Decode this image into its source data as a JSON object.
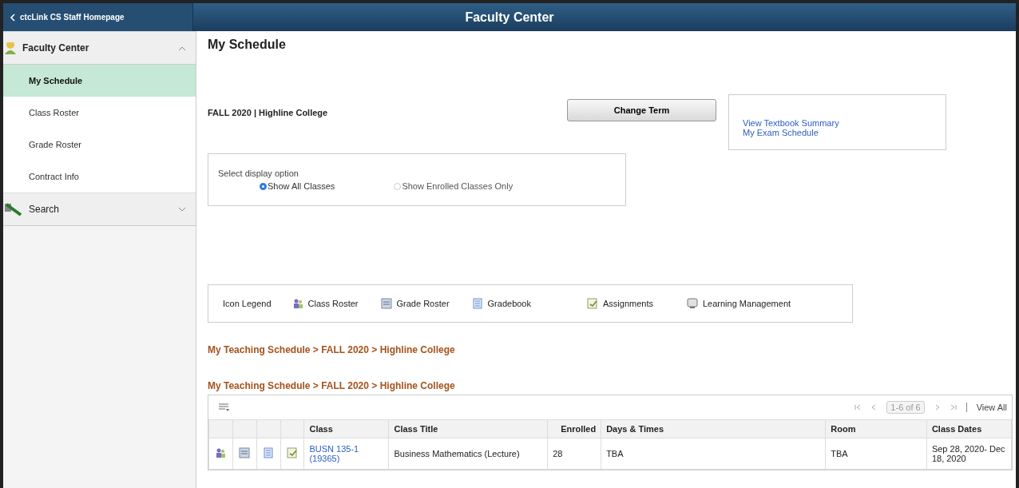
{
  "header": {
    "back_label": "ctcLink CS Staff Homepage",
    "title": "Faculty Center"
  },
  "sidebar": {
    "groups": [
      {
        "label": "Faculty Center",
        "expanded": true,
        "items": [
          {
            "label": "My Schedule",
            "selected": true
          },
          {
            "label": "Class Roster",
            "selected": false
          },
          {
            "label": "Grade Roster",
            "selected": false
          },
          {
            "label": "Contract Info",
            "selected": false
          }
        ]
      },
      {
        "label": "Search",
        "expanded": false
      }
    ]
  },
  "page_title": "My Schedule",
  "term": "FALL 2020 | Highline College",
  "change_term_button": "Change Term",
  "links": [
    "View Textbook Summary",
    "My Exam Schedule"
  ],
  "display_option": {
    "label": "Select display option",
    "options": [
      {
        "label": "Show All Classes",
        "selected": true
      },
      {
        "label": "Show Enrolled Classes Only",
        "selected": false
      }
    ]
  },
  "legend": {
    "label": "Icon Legend",
    "items": [
      {
        "kind": "roster",
        "label": "Class Roster"
      },
      {
        "kind": "grade",
        "label": "Grade Roster"
      },
      {
        "kind": "gradebook",
        "label": "Gradebook"
      },
      {
        "kind": "assign",
        "label": "Assignments"
      },
      {
        "kind": "lms",
        "label": "Learning Management"
      }
    ]
  },
  "breadcrumbs": [
    "My Teaching Schedule > FALL 2020 > Highline College",
    "My Teaching Schedule > FALL 2020 > Highline College"
  ],
  "table": {
    "pager": "1-6 of 6",
    "view_all": "View All",
    "columns": [
      "Class",
      "Class Title",
      "Enrolled",
      "Days & Times",
      "Room",
      "Class Dates"
    ],
    "rows": [
      {
        "class": "BUSN 135-1 (19365)",
        "title": "Business Mathematics (Lecture)",
        "enrolled": "28",
        "days_times": "TBA",
        "room": "TBA",
        "dates": "Sep 28, 2020- Dec 18, 2020"
      }
    ]
  }
}
